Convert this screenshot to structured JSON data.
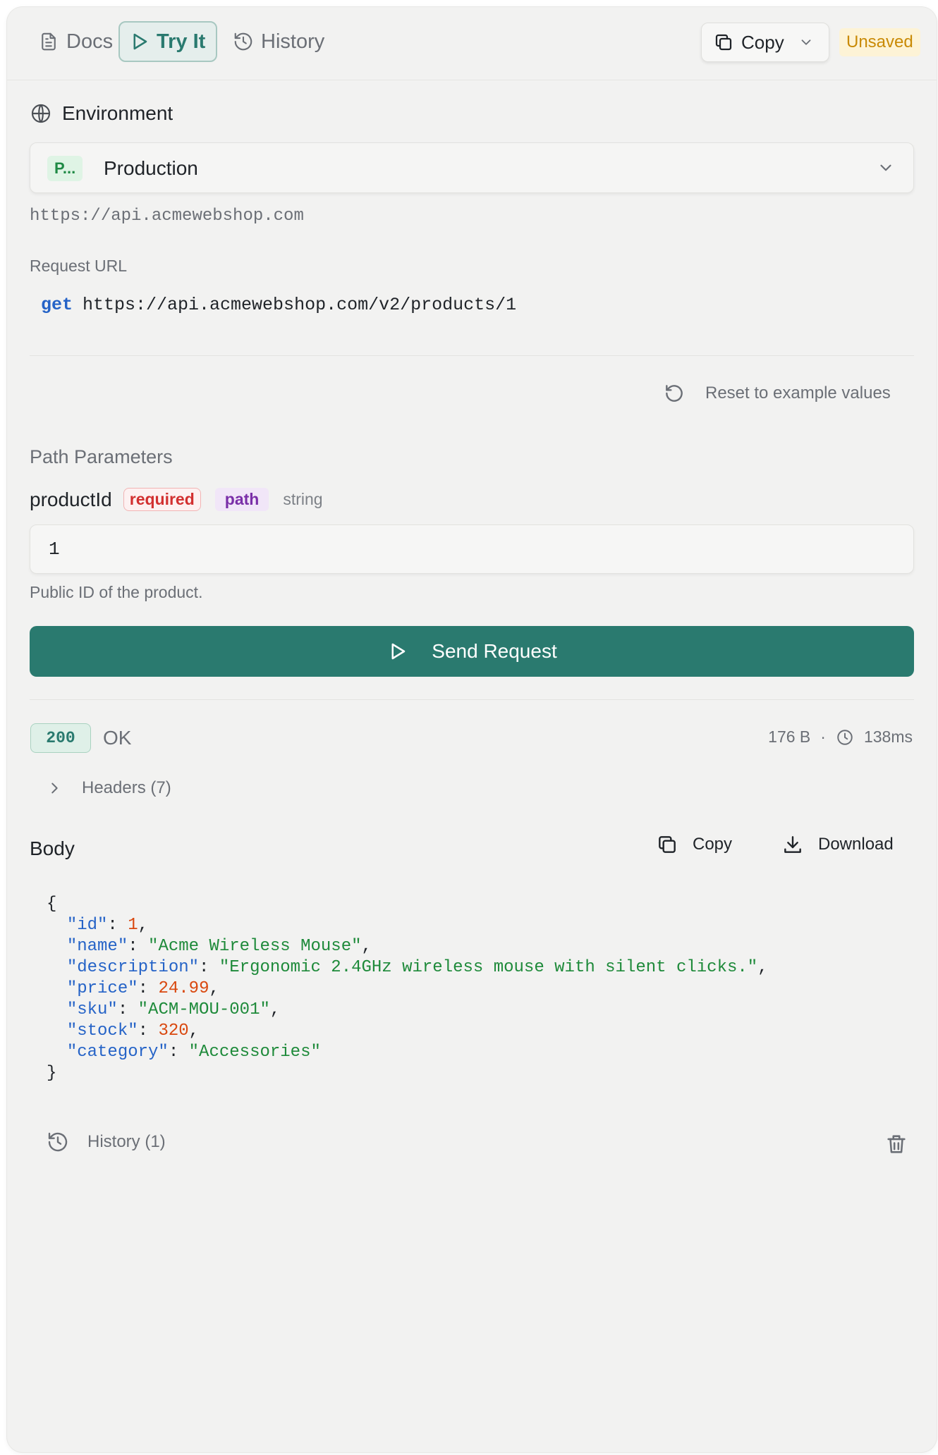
{
  "tabs": [
    {
      "label": "Docs",
      "icon": "document-icon"
    },
    {
      "label": "Try It",
      "icon": "play-icon",
      "active": true
    },
    {
      "label": "History",
      "icon": "history-icon"
    }
  ],
  "toolbar": {
    "copy_label": "Copy",
    "status_badge": "Unsaved"
  },
  "environment": {
    "heading": "Environment",
    "chip": "P...",
    "selected": "Production",
    "base_url": "https://api.acmewebshop.com"
  },
  "request": {
    "label": "Request URL",
    "method": "get",
    "url": "https://api.acmewebshop.com/v2/products/1"
  },
  "reset_label": "Reset to example values",
  "path_params": {
    "title": "Path Parameters",
    "name": "productId",
    "required_badge": "required",
    "in_badge": "path",
    "type": "string",
    "value": "1",
    "description": "Public ID of the product."
  },
  "send_label": "Send Request",
  "response": {
    "status_code": "200",
    "status_text": "OK",
    "size": "176 B",
    "separator": "·",
    "time": "138ms",
    "headers_label": "Headers (7)",
    "body_title": "Body",
    "copy_label": "Copy",
    "download_label": "Download",
    "body": {
      "open": "{",
      "close": "}",
      "fields": [
        {
          "key": "\"id\"",
          "value": "1",
          "kind": "n"
        },
        {
          "key": "\"name\"",
          "value": "\"Acme Wireless Mouse\"",
          "kind": "s"
        },
        {
          "key": "\"description\"",
          "value": "\"Ergonomic 2.4GHz wireless mouse with silent clicks.\"",
          "kind": "s"
        },
        {
          "key": "\"price\"",
          "value": "24.99",
          "kind": "n"
        },
        {
          "key": "\"sku\"",
          "value": "\"ACM-MOU-001\"",
          "kind": "s"
        },
        {
          "key": "\"stock\"",
          "value": "320",
          "kind": "n"
        },
        {
          "key": "\"category\"",
          "value": "\"Accessories\"",
          "kind": "s"
        }
      ]
    }
  },
  "history_label": "History (1)",
  "colors": {
    "accent": "#2a7a6f",
    "method_blue": "#2563c7",
    "string_green": "#1e8a3a",
    "number_orange": "#d9480f",
    "required_red": "#d23030",
    "path_purple": "#7a2fa8",
    "unsaved_amber": "#c98a06"
  }
}
